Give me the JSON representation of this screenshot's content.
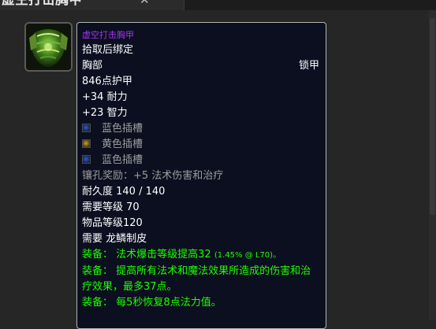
{
  "tab": {
    "title": "虚空打击胸甲",
    "close_glyph": "✕"
  },
  "item": {
    "name": "虚空打击胸甲",
    "binding": "拾取后绑定",
    "slot": "胸部",
    "armor_type": "锁甲",
    "armor": "846点护甲",
    "stats": [
      "+34 耐力",
      "+23 智力"
    ],
    "sockets": [
      {
        "color": "blue",
        "label": "蓝色插槽"
      },
      {
        "color": "yellow",
        "label": "黄色插槽"
      },
      {
        "color": "blue",
        "label": "蓝色插槽"
      }
    ],
    "socket_bonus": "镶孔奖励：+5 法术伤害和治疗",
    "durability": "耐久度 140 / 140",
    "required_level": "需要等级 70",
    "item_level": "物品等级120",
    "profession_requirement": "需要 龙鳞制皮",
    "equip_effects": [
      {
        "prefix": "装备：",
        "text": "法术爆击等级提高32",
        "note": "(1.45% @ L70)。"
      },
      {
        "prefix": "装备：",
        "text": "提高所有法术和魔法效果所造成的伤害和治疗效果，最多37点。",
        "note": ""
      },
      {
        "prefix": "装备：",
        "text": "每5秒恢复8点法力值。",
        "note": ""
      }
    ]
  },
  "colors": {
    "epic": "#a335ee",
    "socket_gray": "#9d9d9d",
    "equip_green": "#1eff00",
    "tooltip_bg": "#0b0f1f",
    "tooltip_border": "#b4b4b4"
  },
  "icon": "mail-chest-armor-icon"
}
